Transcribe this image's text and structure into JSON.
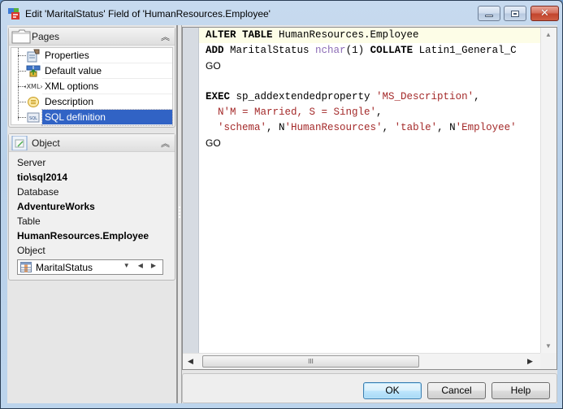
{
  "window": {
    "title": "Edit 'MaritalStatus' Field of 'HumanResources.Employee'",
    "controls": {
      "minimize": "minimize",
      "maximize": "maximize",
      "close": "close"
    }
  },
  "pages_panel": {
    "title": "Pages",
    "items": [
      {
        "label": "Properties",
        "icon": "properties-icon",
        "selected": false
      },
      {
        "label": "Default value",
        "icon": "default-value-icon",
        "selected": false
      },
      {
        "label": "XML options",
        "icon": "xml-icon",
        "selected": false
      },
      {
        "label": "Description",
        "icon": "description-icon",
        "selected": false
      },
      {
        "label": "SQL definition",
        "icon": "sql-icon",
        "selected": true
      }
    ]
  },
  "object_panel": {
    "title": "Object",
    "server_label": "Server",
    "server_value": "tio\\sql2014",
    "database_label": "Database",
    "database_value": "AdventureWorks",
    "table_label": "Table",
    "table_value": "HumanResources.Employee",
    "object_label": "Object",
    "object_value": "MaritalStatus"
  },
  "editor": {
    "lines": [
      [
        {
          "t": "ALTER TABLE",
          "c": "kw"
        },
        {
          "t": " HumanResources.Employee",
          "c": "pl"
        }
      ],
      [
        {
          "t": "ADD",
          "c": "kw"
        },
        {
          "t": " MaritalStatus ",
          "c": "pl"
        },
        {
          "t": "nchar",
          "c": "ty"
        },
        {
          "t": "(1) ",
          "c": "pl"
        },
        {
          "t": "COLLATE",
          "c": "kw"
        },
        {
          "t": " Latin1_General_C",
          "c": "pl"
        }
      ],
      [
        {
          "t": "GO",
          "c": "go"
        }
      ],
      [
        {
          "t": "",
          "c": "pl"
        }
      ],
      [
        {
          "t": "EXEC",
          "c": "kw"
        },
        {
          "t": " sp_addextendedproperty ",
          "c": "pl"
        },
        {
          "t": "'MS_Description'",
          "c": "st"
        },
        {
          "t": ",",
          "c": "pl"
        }
      ],
      [
        {
          "t": "  N'M = Married, S = Single'",
          "c": "st"
        },
        {
          "t": ",",
          "c": "pl"
        }
      ],
      [
        {
          "t": "  'schema'",
          "c": "st"
        },
        {
          "t": ", N",
          "c": "pl"
        },
        {
          "t": "'HumanResources'",
          "c": "st"
        },
        {
          "t": ", ",
          "c": "pl"
        },
        {
          "t": "'table'",
          "c": "st"
        },
        {
          "t": ", N",
          "c": "pl"
        },
        {
          "t": "'Employee'",
          "c": "st"
        }
      ],
      [
        {
          "t": "GO",
          "c": "go"
        }
      ]
    ],
    "hscroll_grip": "III"
  },
  "buttons": {
    "ok": "OK",
    "cancel": "Cancel",
    "help": "Help"
  }
}
